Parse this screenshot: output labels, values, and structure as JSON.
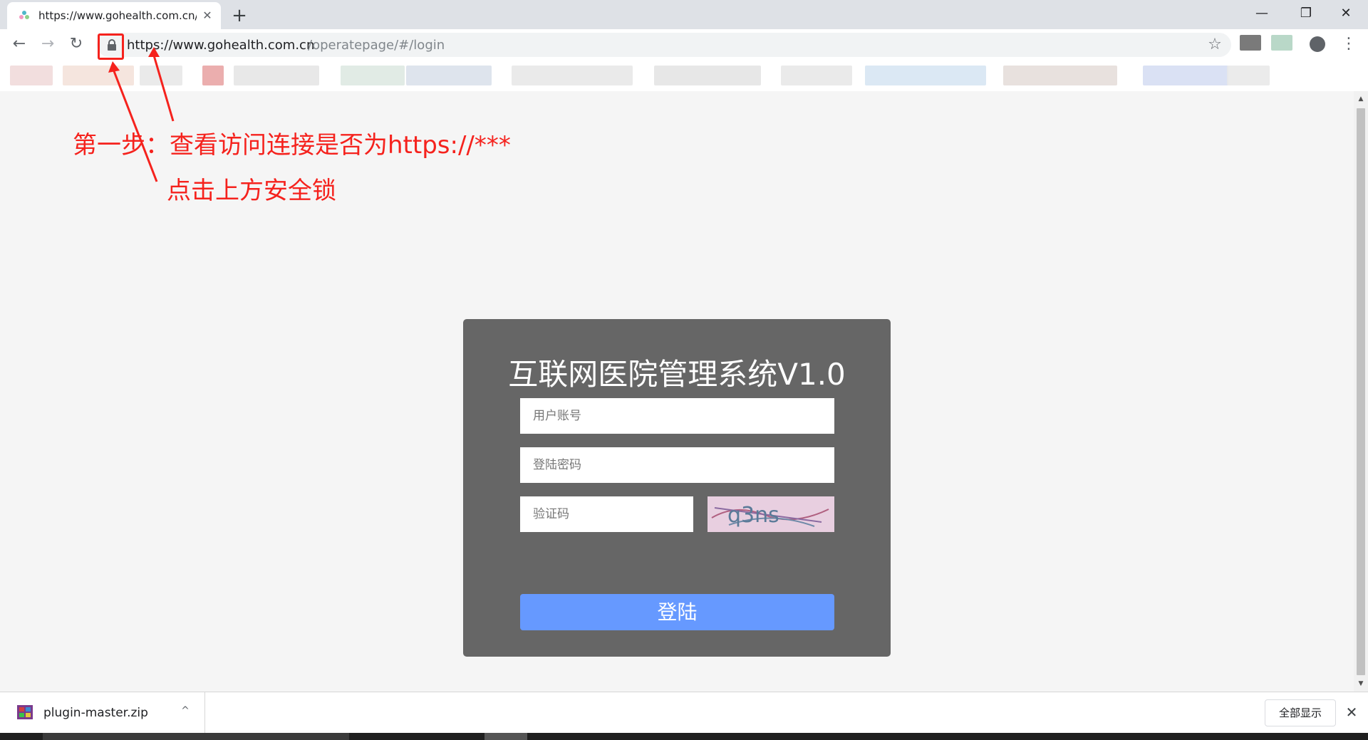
{
  "browser": {
    "tab": {
      "title": "https://www.gohealth.com.cn/",
      "close_glyph": "✕"
    },
    "new_tab_glyph": "+",
    "window_controls": {
      "minimize": "—",
      "restore": "❐",
      "close": "✕"
    },
    "nav": {
      "back": "←",
      "forward": "→",
      "reload": "↻"
    },
    "address": {
      "host": "https://www.gohealth.com.cn",
      "path": "/operatepage/#/login"
    },
    "icons": [
      "lock-icon",
      "star-icon",
      "account-icon",
      "menu-icon"
    ],
    "menu_glyph": "⋮",
    "star_glyph": "☆"
  },
  "annotations": {
    "step1": "第一步：查看访问连接是否为https://***",
    "step1_sub": "点击上方安全锁",
    "color": "#f5221d"
  },
  "login": {
    "title": "互联网医院管理系统V1.0",
    "username_placeholder": "用户账号",
    "password_placeholder": "登陆密码",
    "captcha_placeholder": "验证码",
    "captcha_text": "q3ns",
    "submit_label": "登陆",
    "button_color": "#6699ff"
  },
  "downloads": {
    "file_name": "plugin-master.zip",
    "show_all": "全部显示",
    "close_glyph": "✕",
    "chevron": "^"
  }
}
